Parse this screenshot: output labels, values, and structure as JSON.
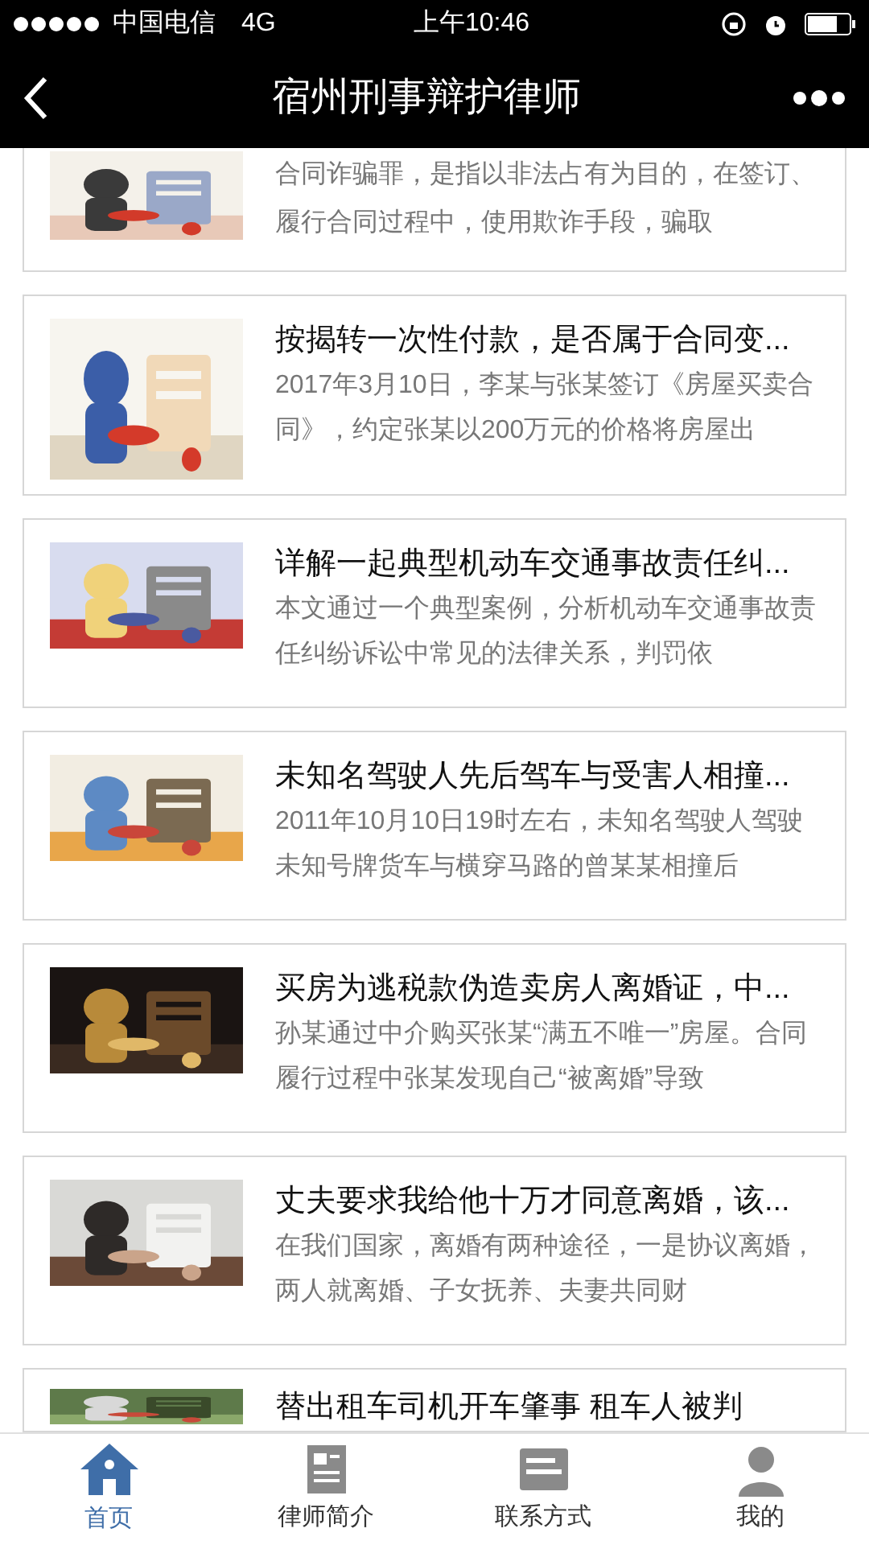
{
  "status_bar": {
    "carrier": "中国电信",
    "network": "4G",
    "time": "上午10:46"
  },
  "nav_bar": {
    "title": "宿州刑事辩护律师"
  },
  "articles": [
    {
      "kind": "partial",
      "description": "合同诈骗罪，是指以非法占有为目的，在签订、履行合同过程中，使用欺诈手段，骗取"
    },
    {
      "kind": "full",
      "title": "按揭转一次性付款，是否属于合同变...",
      "description": "2017年3月10日，李某与张某签订《房屋买卖合同》，约定张某以200万元的价格将房屋出"
    },
    {
      "kind": "full",
      "title": "详解一起典型机动车交通事故责任纠...",
      "description": "本文通过一个典型案例，分析机动车交通事故责任纠纷诉讼中常见的法律关系，判罚依"
    },
    {
      "kind": "full",
      "title": "未知名驾驶人先后驾车与受害人相撞...",
      "description": "2011年10月10日19时左右，未知名驾驶人驾驶未知号牌货车与横穿马路的曾某某相撞后"
    },
    {
      "kind": "full",
      "title": "买房为逃税款伪造卖房人离婚证，中...",
      "description": "孙某通过中介购买张某“满五不唯一”房屋。合同履行过程中张某发现自己“被离婚”导致"
    },
    {
      "kind": "full",
      "title": "丈夫要求我给他十万才同意离婚，该...",
      "description": "在我们国家，离婚有两种途径，一是协议离婚，两人就离婚、子女抚养、夫妻共同财"
    },
    {
      "kind": "cut",
      "title": "替出租车司机开车肇事 租车人被判"
    }
  ],
  "tab_bar": [
    {
      "label": "首页",
      "selected": true
    },
    {
      "label": "律师简介",
      "selected": false
    },
    {
      "label": "联系方式",
      "selected": false
    },
    {
      "label": "我的",
      "selected": false
    }
  ]
}
